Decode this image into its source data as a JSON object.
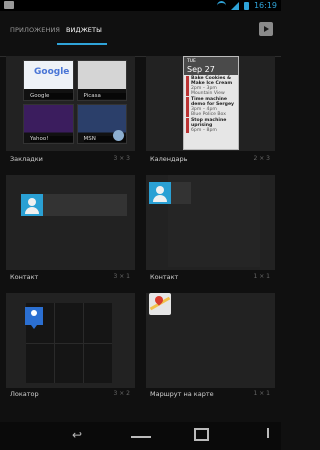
{
  "status": {
    "time": "16:19"
  },
  "tabs": {
    "apps": "ПРИЛОЖЕНИЯ",
    "widgets": "ВИДЖЕТЫ"
  },
  "widgets": [
    {
      "name": "Закладки",
      "size": "3 × 3",
      "thumbs": [
        {
          "label": "Google",
          "logo": "Google"
        },
        {
          "label": "Picasa"
        },
        {
          "label": "Yahoo!"
        },
        {
          "label": "MSN"
        }
      ]
    },
    {
      "name": "Календарь",
      "size": "2 × 3",
      "calendar": {
        "day": "TUE",
        "date": "Sep 27",
        "events": [
          {
            "title": "Bake Cookies & Make Ice Cream",
            "time": "2pm – 3pm",
            "place": "Mountain View"
          },
          {
            "title": "Time machine demo for Sergey",
            "time": "3pm – 4pm",
            "place": "Blue Police Box"
          },
          {
            "title": "Stop machine uprising",
            "time": "6pm – 8pm",
            "place": ""
          }
        ]
      }
    },
    {
      "name": "Контакт",
      "size": "3 × 1"
    },
    {
      "name": "Контакт",
      "size": "1 × 1"
    },
    {
      "name": "Локатор",
      "size": "3 × 2"
    },
    {
      "name": "Маршрут на карте",
      "size": "1 × 1"
    }
  ]
}
